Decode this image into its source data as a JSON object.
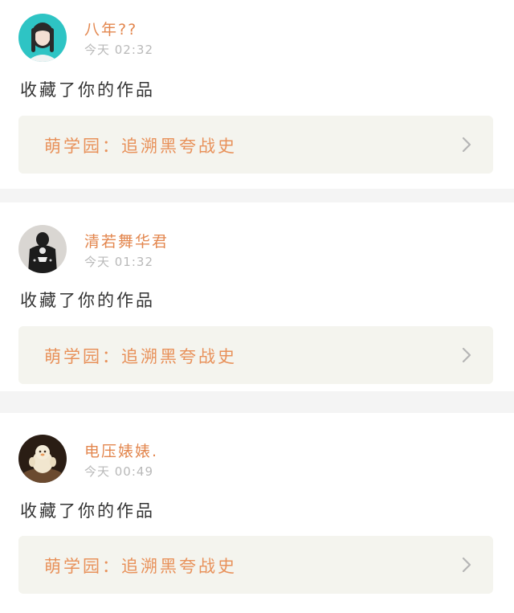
{
  "items": [
    {
      "username": "八年??",
      "time": "今天 02:32",
      "action": "收藏了你的作品",
      "work_title": "萌学园：追溯黑夸战史",
      "avatar_icon": "girl-portrait-avatar"
    },
    {
      "username": "清若舞华君",
      "time": "今天 01:32",
      "action": "收藏了你的作品",
      "work_title": "萌学园：追溯黑夸战史",
      "avatar_icon": "dark-outfit-portrait-avatar"
    },
    {
      "username": "电压婊婊.",
      "time": "今天 00:49",
      "action": "收藏了你的作品",
      "work_title": "萌学园：追溯黑夸战史",
      "avatar_icon": "toy-figure-avatar"
    }
  ],
  "colors": {
    "username": "#e3874f",
    "work_title": "#e8915a",
    "time": "#b9b9b9",
    "action": "#333333",
    "link_bg": "#f4f4ee",
    "separator": "#f4f4f4"
  }
}
